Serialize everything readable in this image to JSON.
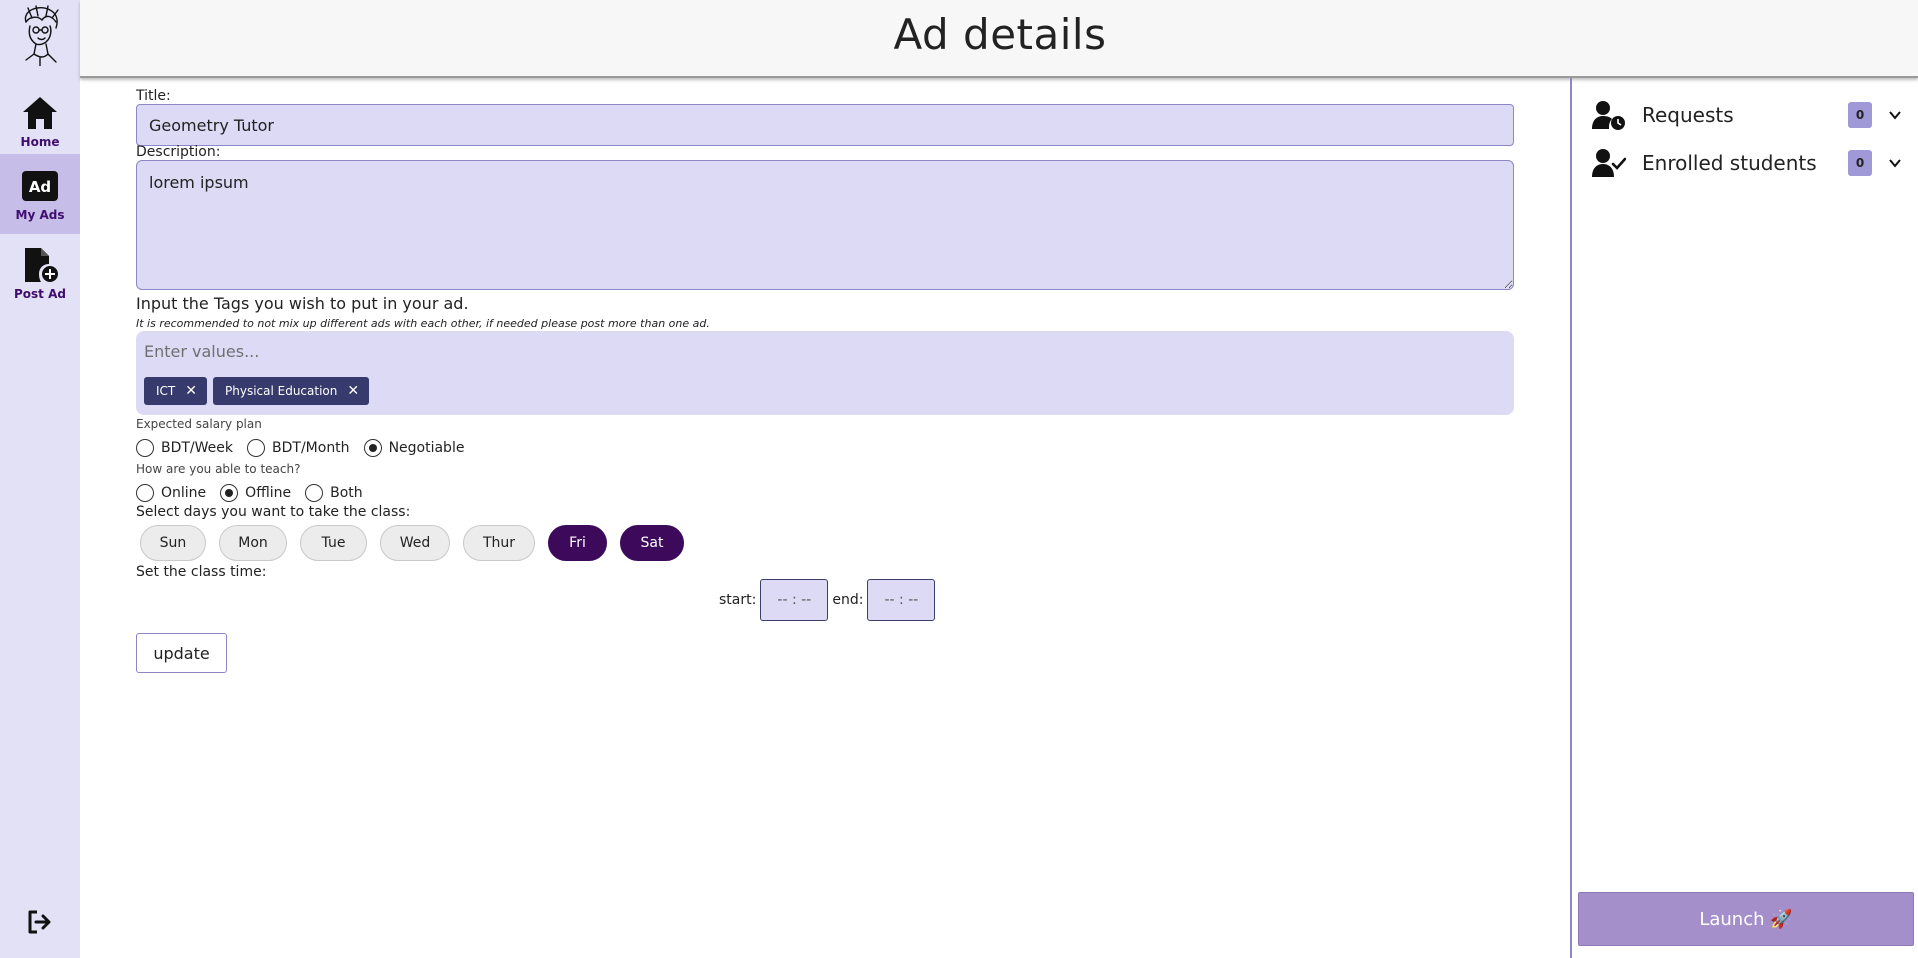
{
  "header": {
    "title": "Ad details"
  },
  "sidebar": {
    "items": [
      {
        "label": "Home",
        "icon": "home-icon"
      },
      {
        "label": "My Ads",
        "icon": "ad-icon"
      },
      {
        "label": "Post Ad",
        "icon": "post-file-icon"
      }
    ],
    "active": "My Ads",
    "active_color": "#c6bde8",
    "logout_icon": "logout-icon"
  },
  "form": {
    "title_label": "Title:",
    "title_value": "Geometry Tutor",
    "description_label": "Description:",
    "description_value": "lorem ipsum",
    "tags_label": "Input the Tags you wish to put in your ad.",
    "tags_note": "It is recommended to not mix up different ads with each other, if needed please post more than one ad.",
    "tags_placeholder": "Enter values...",
    "tags": [
      "ICT",
      "Physical Education"
    ],
    "salary_label": "Expected salary plan",
    "salary_options": [
      "BDT/Week",
      "BDT/Month",
      "Negotiable"
    ],
    "salary_selected": "Negotiable",
    "teach_label": "How are you able to teach?",
    "teach_options": [
      "Online",
      "Offline",
      "Both"
    ],
    "teach_selected": "Offline",
    "days_label": "Select days you want to take the class:",
    "days": [
      "Sun",
      "Mon",
      "Tue",
      "Wed",
      "Thur",
      "Fri",
      "Sat"
    ],
    "days_selected": [
      "Fri",
      "Sat"
    ],
    "time_label": "Set the class time:",
    "start_label": "start:",
    "start_value": "-- : --",
    "end_label": "end:",
    "end_value": "-- : --",
    "update_label": "update"
  },
  "panel": {
    "requests_label": "Requests",
    "requests_count": "0",
    "enrolled_label": "Enrolled students",
    "enrolled_count": "0",
    "launch_label": "Launch 🚀"
  },
  "colors": {
    "accent": "#3d0a5b",
    "field_bg": "#dcdaf4",
    "chip_bg": "#363a6c",
    "launch_bg": "#a48fca",
    "sidebar_bg": "#e3e1f5"
  }
}
